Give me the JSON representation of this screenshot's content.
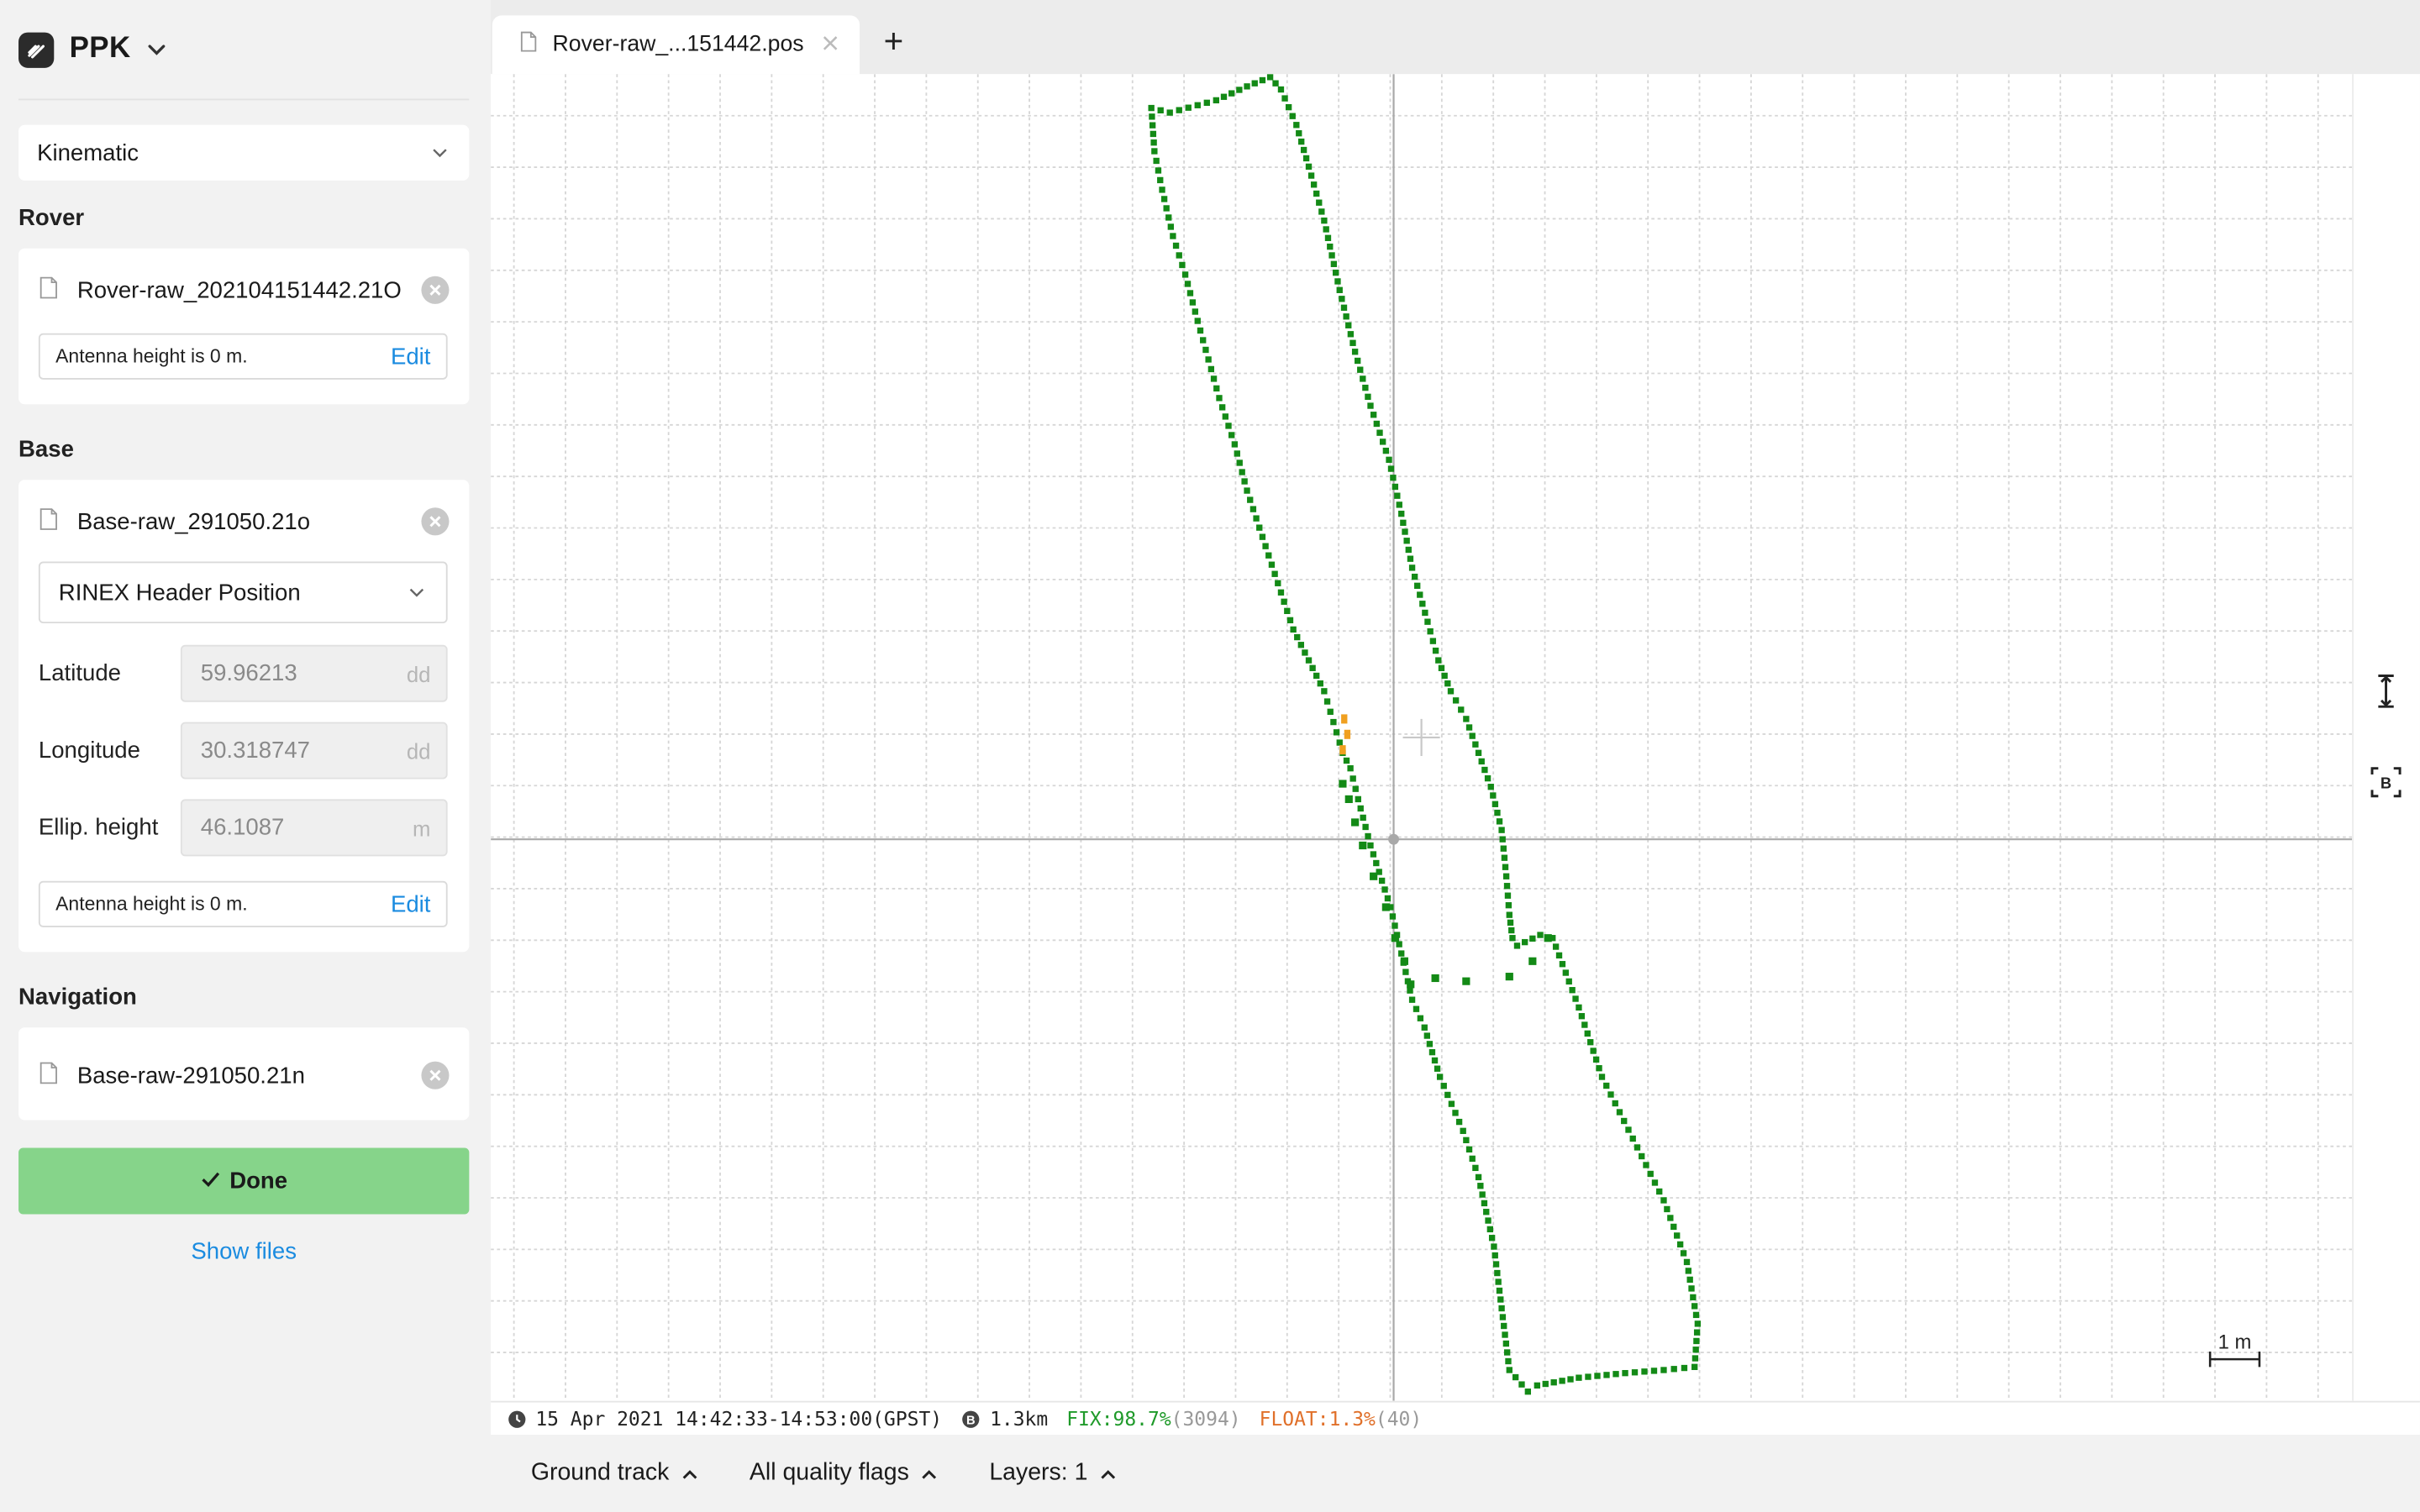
{
  "app": {
    "title": "PPK"
  },
  "mode_select": {
    "value": "Kinematic"
  },
  "rover": {
    "section_label": "Rover",
    "file_name": "Rover-raw_202104151442.21O",
    "antenna_text": "Antenna height is 0 m.",
    "edit_label": "Edit"
  },
  "base": {
    "section_label": "Base",
    "file_name": "Base-raw_291050.21o",
    "position_select": "RINEX Header Position",
    "latitude": {
      "label": "Latitude",
      "value": "59.96213",
      "unit": "dd"
    },
    "longitude": {
      "label": "Longitude",
      "value": "30.318747",
      "unit": "dd"
    },
    "ellip_height": {
      "label": "Ellip. height",
      "value": "46.1087",
      "unit": "m"
    },
    "antenna_text": "Antenna height is 0 m.",
    "edit_label": "Edit"
  },
  "navigation": {
    "section_label": "Navigation",
    "file_name": "Base-raw-291050.21n"
  },
  "actions": {
    "done_label": "Done",
    "show_files_label": "Show files"
  },
  "tabs": [
    {
      "label": "Rover-raw_...151442.pos"
    }
  ],
  "tab_add_label": "+",
  "map": {
    "scale_label": "1 m",
    "track_color_fix": "#138a16",
    "track_color_float": "#f0a020"
  },
  "status": {
    "time_range": "15 Apr 2021 14:42:33-14:53:00(GPST)",
    "baseline": "1.3km",
    "fix_text": "FIX:98.7%",
    "fix_count": "(3094)",
    "float_text": "FLOAT:1.3%",
    "float_count": "(40)"
  },
  "bottom": {
    "ground_track": "Ground track",
    "quality_flags": "All quality flags",
    "layers": "Layers: 1"
  },
  "icons": {
    "logo": "ppk-logo-icon",
    "file": "file-icon",
    "clear": "clear-icon",
    "chevron": "chevron-down-icon",
    "check": "check-icon",
    "clock": "clock-icon",
    "base": "base-icon",
    "height": "height-tool-icon",
    "base_tool": "base-tool-icon"
  }
}
